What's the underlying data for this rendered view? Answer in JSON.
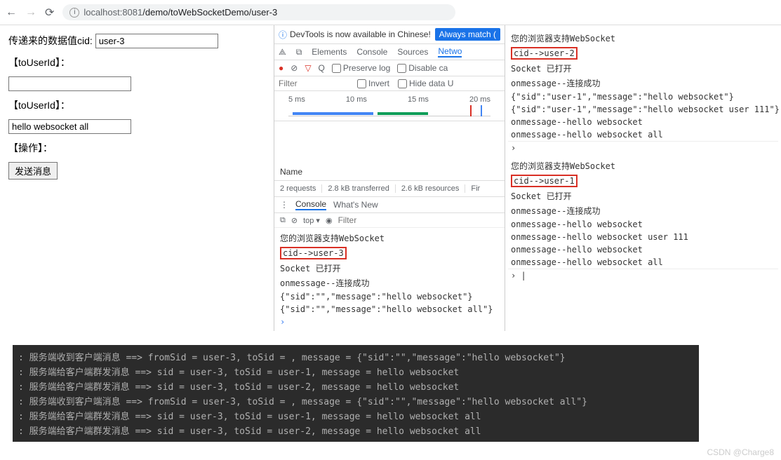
{
  "url": {
    "host": "localhost",
    "port": ":8081",
    "path": "/demo/toWebSocketDemo/user-3"
  },
  "form": {
    "cid_label": "传递来的数据值cid:",
    "cid_value": "user-3",
    "to_user_label1": "【toUserId】：",
    "to_user_value1": "",
    "to_user_label2": "【toUserId】：",
    "to_user_value2": "hello websocket all",
    "ops_label": "【操作】：",
    "send_btn": "发送消息"
  },
  "devtools": {
    "banner_text": "DevTools is now available in Chinese!",
    "banner_btn": "Always match (",
    "tabs": {
      "elements": "Elements",
      "console": "Console",
      "sources": "Sources",
      "network": "Netwo"
    },
    "toolbar": {
      "preserve": "Preserve log",
      "disable": "Disable ca"
    },
    "filter": {
      "placeholder": "Filter",
      "invert": "Invert",
      "hide": "Hide data U"
    },
    "timeline": {
      "t1": "5 ms",
      "t2": "10 ms",
      "t3": "15 ms",
      "t4": "20 ms"
    },
    "name_header": "Name",
    "status": {
      "req": "2 requests",
      "xfer": "2.8 kB transferred",
      "res": "2.6 kB resources",
      "fin": "Fir"
    },
    "console_tabs": {
      "console": "Console",
      "whatsnew": "What's New"
    },
    "console_toolbar": {
      "top": "top ▾",
      "filter": "Filter"
    },
    "console_lines": [
      "您的浏览器支持WebSocket",
      "cid-->user-3",
      "Socket 已打开",
      "onmessage--连接成功",
      "{\"sid\":\"\",\"message\":\"hello websocket\"}",
      "{\"sid\":\"\",\"message\":\"hello websocket all\"}"
    ]
  },
  "right_consoles": {
    "block1": [
      "您的浏览器支持WebSocket",
      "cid-->user-2",
      "Socket 已打开",
      "onmessage--连接成功",
      "{\"sid\":\"user-1\",\"message\":\"hello websocket\"}",
      "{\"sid\":\"user-1\",\"message\":\"hello websocket user 111\"}",
      "onmessage--hello websocket",
      "onmessage--hello websocket all"
    ],
    "block2": [
      "您的浏览器支持WebSocket",
      "cid-->user-1",
      "Socket 已打开",
      "onmessage--连接成功",
      "onmessage--hello websocket",
      "onmessage--hello websocket user 111",
      "onmessage--hello websocket",
      "onmessage--hello websocket all"
    ]
  },
  "server_log": [
    ": 服务端收到客户端消息 ==> fromSid = user-3, toSid = , message = {\"sid\":\"\",\"message\":\"hello websocket\"}",
    ": 服务端给客户端群发消息 ==> sid = user-3, toSid = user-1, message = hello websocket",
    ": 服务端给客户端群发消息 ==> sid = user-3, toSid = user-2, message = hello websocket",
    ": 服务端收到客户端消息 ==> fromSid = user-3, toSid = , message = {\"sid\":\"\",\"message\":\"hello websocket all\"}",
    ": 服务端给客户端群发消息 ==> sid = user-3, toSid = user-1, message = hello websocket all",
    ": 服务端给客户端群发消息 ==> sid = user-3, toSid = user-2, message = hello websocket all"
  ],
  "watermark": "CSDN @Charge8"
}
